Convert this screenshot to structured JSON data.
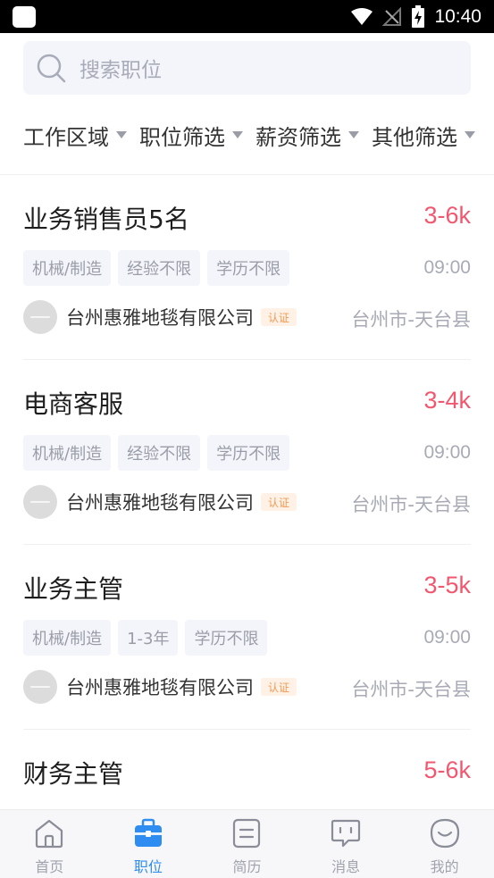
{
  "status_bar": {
    "time": "10:40",
    "icons": [
      "notification-icon",
      "wifi-icon",
      "signal-off-icon",
      "battery-charging-icon"
    ]
  },
  "search": {
    "placeholder": "搜索职位",
    "icon": "search-icon"
  },
  "filters": [
    {
      "label": "工作区域"
    },
    {
      "label": "职位筛选"
    },
    {
      "label": "薪资筛选"
    },
    {
      "label": "其他筛选"
    }
  ],
  "jobs": [
    {
      "title": "业务销售员5名",
      "salary": "3-6k",
      "tags": [
        "机械/制造",
        "经验不限",
        "学历不限"
      ],
      "time": "09:00",
      "company": "台州惠雅地毯有限公司",
      "badge": "认证",
      "location": "台州市-天台县"
    },
    {
      "title": "电商客服",
      "salary": "3-4k",
      "tags": [
        "机械/制造",
        "经验不限",
        "学历不限"
      ],
      "time": "09:00",
      "company": "台州惠雅地毯有限公司",
      "badge": "认证",
      "location": "台州市-天台县"
    },
    {
      "title": "业务主管",
      "salary": "3-5k",
      "tags": [
        "机械/制造",
        "1-3年",
        "学历不限"
      ],
      "time": "09:00",
      "company": "台州惠雅地毯有限公司",
      "badge": "认证",
      "location": "台州市-天台县"
    },
    {
      "title": "财务主管",
      "salary": "5-6k"
    }
  ],
  "tabs": [
    {
      "label": "首页",
      "icon": "home-icon",
      "active": false
    },
    {
      "label": "职位",
      "icon": "briefcase-icon",
      "active": true
    },
    {
      "label": "简历",
      "icon": "resume-icon",
      "active": false
    },
    {
      "label": "消息",
      "icon": "message-icon",
      "active": false
    },
    {
      "label": "我的",
      "icon": "profile-icon",
      "active": false
    }
  ],
  "colors": {
    "accent": "#2f8cf0",
    "salary": "#f2576f",
    "badge_text": "#f29a52",
    "badge_bg": "#fff1e6"
  }
}
